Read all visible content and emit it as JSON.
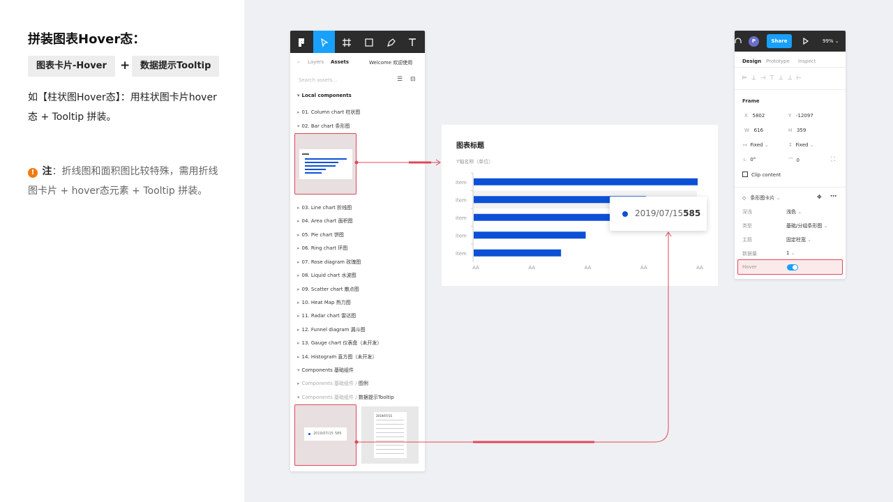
{
  "left": {
    "title": "拼装图表Hover态：",
    "tag1": "图表卡片-Hover",
    "plus": "+",
    "tag2": "数据提示Tooltip",
    "desc": "如【柱状图Hover态】：用柱状图卡片hover态 + Tooltip 拼装。",
    "note_icon": "!",
    "note_label": "注",
    "note_text": "：折线图和面积图比较特殊，需用折线图卡片 + hover态元素 + Tooltip 拼装。"
  },
  "figma_left": {
    "tabs": [
      "Layers",
      "Assets"
    ],
    "file_name": "Welcome 欢迎使用",
    "search_placeholder": "Search assets...",
    "section": "Local components",
    "layers": [
      "01. Column chart 柱状图",
      "02. Bar chart 条形图",
      "03. Line chart 折线图",
      "04. Area chart 面积图",
      "05. Pie chart 饼图",
      "06. Ring chart 环图",
      "07. Rose diagram 玫瑰图",
      "08. Liquid chart 水波图",
      "09. Scatter chart 散点图",
      "10. Heat Map 热力图",
      "11. Radar chart 雷达图",
      "12. Funnel diagram 漏斗图",
      "13. Gauge chart 仪表盘（未开发）",
      "14. Histogram 直方图（未开发）",
      "Components 基础组件"
    ],
    "path1_prefix": "Components 基础组件 / ",
    "path1_name": "图例",
    "path2_prefix": "Components 基础组件 / ",
    "path2_name": "数据提示Tooltip",
    "thumb_tooltip_date": "2019/07/15",
    "thumb_tooltip_value": "585",
    "thumb2_date": "2019/07/15"
  },
  "chart_card": {
    "title": "图表标题",
    "y_name": "Y轴名称（单位）"
  },
  "chart_data": {
    "type": "bar",
    "orientation": "horizontal",
    "title": "图表标题",
    "ylabel": "Y轴名称（单位）",
    "categories": [
      "item",
      "item",
      "item",
      "item",
      "item"
    ],
    "values": [
      100,
      77,
      72,
      50,
      39
    ],
    "x_tick_labels": [
      "AA",
      "AA",
      "AA",
      "AA",
      "AA"
    ],
    "xlim": [
      0,
      100
    ],
    "color": "#0b50d6",
    "hovered_index": 1
  },
  "tooltip": {
    "date": "2019/07/15",
    "value": "585",
    "dot_color": "#0b50d6"
  },
  "figma_right": {
    "avatar": "P",
    "share": "Share",
    "zoom": "99%",
    "tabs": [
      "Design",
      "Prototype",
      "Inspect"
    ],
    "frame_label": "Frame",
    "x_label": "X",
    "x_val": "5802",
    "y_label": "Y",
    "y_val": "-12097",
    "w_label": "W",
    "w_val": "616",
    "h_label": "H",
    "h_val": "359",
    "fixed1": "Fixed",
    "fixed2": "Fixed",
    "rot_val": "0°",
    "radius_val": "0",
    "clip": "Clip content",
    "component_name": "条形图卡片",
    "props": [
      {
        "label": "深浅",
        "value": "浅色"
      },
      {
        "label": "类型",
        "value": "基础/分组条形图"
      },
      {
        "label": "主题",
        "value": "固定柱宽"
      },
      {
        "label": "数据量",
        "value": "1"
      }
    ],
    "hover_label": "Hover"
  },
  "colors": {
    "accent_blue": "#18a0fb",
    "bar_blue": "#0b50d6",
    "highlight_red": "#e0475a"
  }
}
